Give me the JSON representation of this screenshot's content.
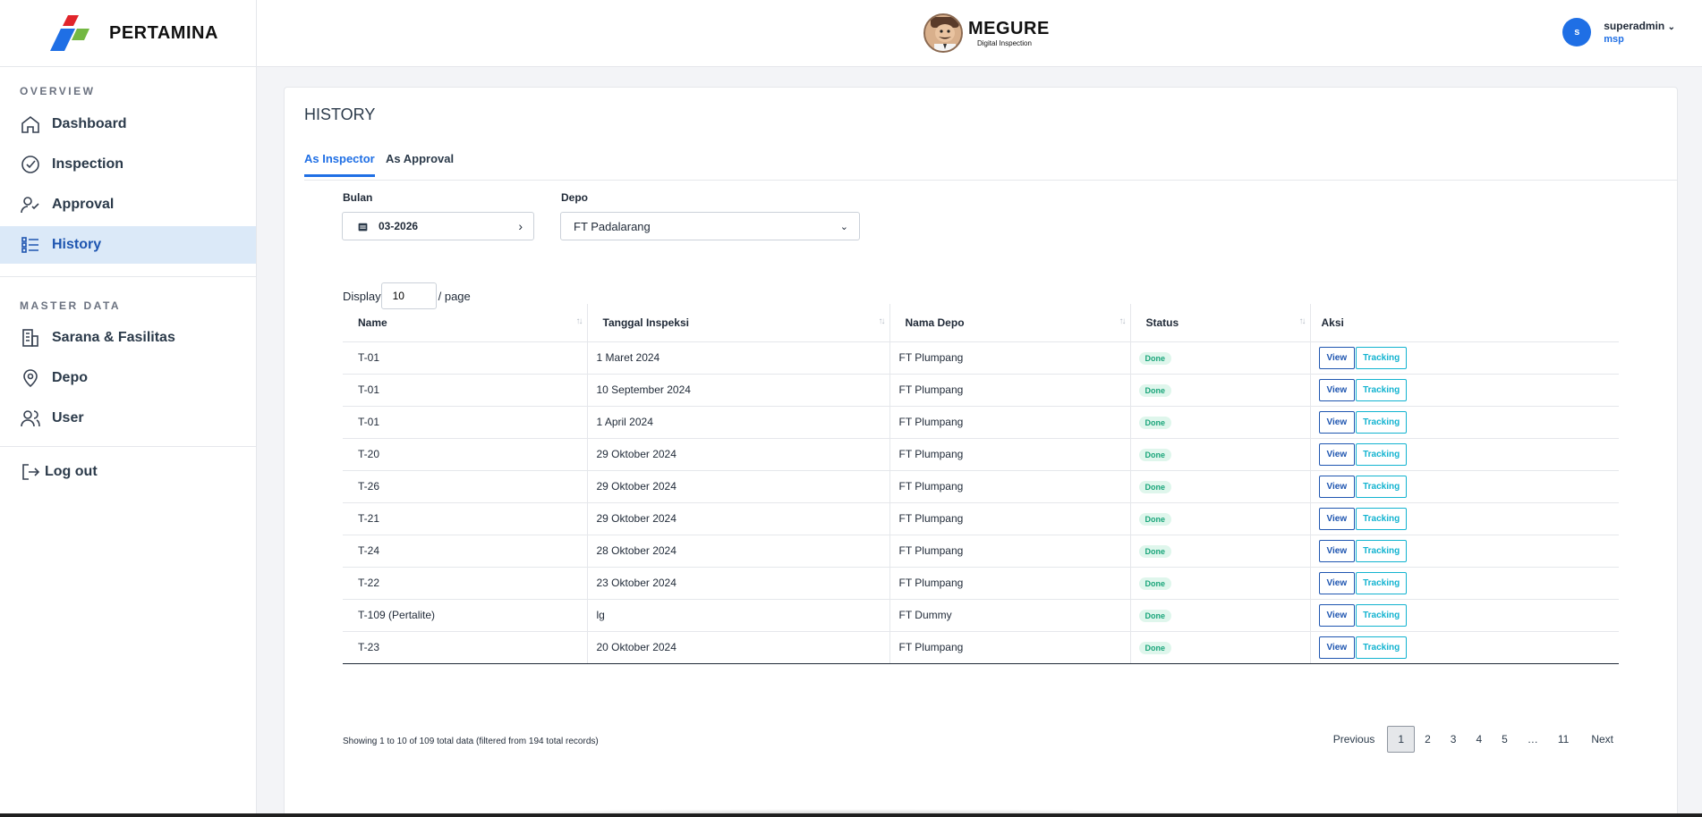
{
  "brand": {
    "name": "PERTAMINA",
    "logo_icon": "pertamina-logo-icon"
  },
  "sidebar": {
    "overview_label": "OVERVIEW",
    "overview_items": [
      {
        "label": "Dashboard",
        "icon": "home-icon"
      },
      {
        "label": "Inspection",
        "icon": "check-circle-icon"
      },
      {
        "label": "Approval",
        "icon": "user-check-icon"
      },
      {
        "label": "History",
        "icon": "list-icon",
        "active": true
      }
    ],
    "master_label": "MASTER DATA",
    "master_items": [
      {
        "label": "Sarana & Fasilitas",
        "icon": "building-icon"
      },
      {
        "label": "Depo",
        "icon": "map-pin-icon"
      },
      {
        "label": "User",
        "icon": "users-icon"
      }
    ],
    "logout_label": "Log out"
  },
  "header": {
    "app_title": "MEGURE",
    "app_subtitle": "Digital Inspection",
    "user_initial": "s",
    "user_name": "superadmin",
    "user_org": "msp"
  },
  "page": {
    "title": "HISTORY",
    "tabs": [
      "As Inspector",
      "As Approval"
    ],
    "active_tab": "As Inspector",
    "filters": {
      "bulan_label": "Bulan",
      "bulan_value": "03-2026",
      "depo_label": "Depo",
      "depo_value": "FT Padalarang"
    },
    "display_prefix": "Display",
    "display_value": "10",
    "display_suffix": "/ page"
  },
  "table": {
    "columns": [
      "Name",
      "Tanggal Inspeksi",
      "Nama Depo",
      "Status",
      "Aksi"
    ],
    "view_label": "View",
    "tracking_label": "Tracking",
    "rows": [
      {
        "name": "T-01",
        "tanggal": "1 Maret 2024",
        "depo": "FT Plumpang",
        "status": "Done"
      },
      {
        "name": "T-01",
        "tanggal": "10 September 2024",
        "depo": "FT Plumpang",
        "status": "Done"
      },
      {
        "name": "T-01",
        "tanggal": "1 April 2024",
        "depo": "FT Plumpang",
        "status": "Done"
      },
      {
        "name": "T-20",
        "tanggal": "29 Oktober 2024",
        "depo": "FT Plumpang",
        "status": "Done"
      },
      {
        "name": "T-26",
        "tanggal": "29 Oktober 2024",
        "depo": "FT Plumpang",
        "status": "Done"
      },
      {
        "name": "T-21",
        "tanggal": "29 Oktober 2024",
        "depo": "FT Plumpang",
        "status": "Done"
      },
      {
        "name": "T-24",
        "tanggal": "28 Oktober 2024",
        "depo": "FT Plumpang",
        "status": "Done"
      },
      {
        "name": "T-22",
        "tanggal": "23 Oktober 2024",
        "depo": "FT Plumpang",
        "status": "Done"
      },
      {
        "name": "T-109 (Pertalite)",
        "tanggal": "lg",
        "depo": "FT Dummy",
        "status": "Done"
      },
      {
        "name": "T-23",
        "tanggal": "20 Oktober 2024",
        "depo": "FT Plumpang",
        "status": "Done"
      }
    ]
  },
  "footer": {
    "info": "Showing 1 to 10 of 109 total data (filtered from 194 total records)",
    "previous": "Previous",
    "pages": [
      "1",
      "2",
      "3",
      "4",
      "5",
      "…",
      "11"
    ],
    "current_page": "1",
    "next": "Next"
  },
  "colors": {
    "accent": "#1f6fe5",
    "active_bg": "#dbe9f8",
    "done": "#1aa57a",
    "tracking": "#12b3d0"
  }
}
